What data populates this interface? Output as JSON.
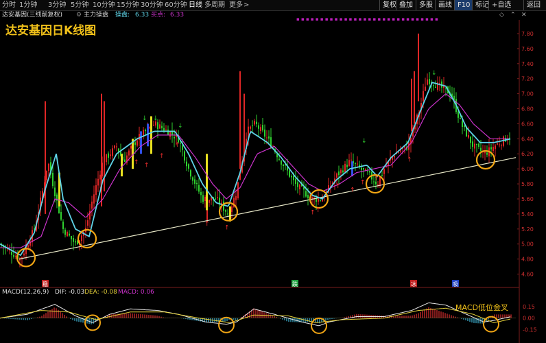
{
  "topbar": {
    "periods": [
      "分时",
      "1分钟",
      "3分钟",
      "5分钟",
      "10分钟",
      "15分钟",
      "30分钟",
      "60分钟",
      "日线",
      "多周期",
      "更多"
    ],
    "active": "日线",
    "right_buttons": [
      "复权",
      "叠加",
      "多股",
      "画线",
      "F10",
      "标记",
      "+自选",
      "返回"
    ],
    "more_arrow": ">"
  },
  "titlebar": {
    "stock_label": "达安基因(三线前复权)",
    "indicator_name": "主力操盘",
    "op_label": "操盘:",
    "op_value": "6.33",
    "buy_label": "买点:",
    "buy_value": "6.33"
  },
  "overlay_title": "达安基因日K线图",
  "macd": {
    "label": "MACD(12,26,9)",
    "dif": "DIF: -0.03",
    "dea": "DEA: -0.08",
    "macd": "MACD: 0.06",
    "note": "MACD低位金叉"
  },
  "signal_labels": [
    "稳",
    "跌",
    "冰",
    "吸"
  ],
  "colors": {
    "up": "#e02626",
    "down": "#2fd02f",
    "fast_line": "#5fd4e8",
    "slow_line": "#cc33cc",
    "trend_line": "#e8e8c8",
    "circle": "#f2a614",
    "axis_text": "#d03030"
  },
  "chart_data": [
    {
      "type": "candlestick",
      "title": "达安基因日K线图",
      "y_ticks": [
        "7.80",
        "7.60",
        "7.40",
        "7.20",
        "7.00",
        "6.80",
        "6.60",
        "6.40",
        "6.20",
        "6.00",
        "5.80",
        "5.60",
        "5.40",
        "5.20",
        "5.00",
        "4.80",
        "4.60"
      ],
      "ylim": [
        4.55,
        7.9
      ],
      "close_keypoints": [
        [
          0,
          5.0
        ],
        [
          30,
          4.8
        ],
        [
          50,
          5.2
        ],
        [
          62,
          5.7
        ],
        [
          70,
          6.1
        ],
        [
          82,
          5.6
        ],
        [
          92,
          5.2
        ],
        [
          110,
          5.0
        ],
        [
          125,
          5.2
        ],
        [
          135,
          5.6
        ],
        [
          150,
          6.1
        ],
        [
          170,
          6.3
        ],
        [
          180,
          6.1
        ],
        [
          200,
          6.4
        ],
        [
          225,
          6.6
        ],
        [
          245,
          6.5
        ],
        [
          260,
          6.4
        ],
        [
          275,
          6.0
        ],
        [
          295,
          5.6
        ],
        [
          315,
          5.6
        ],
        [
          333,
          5.4
        ],
        [
          345,
          5.7
        ],
        [
          360,
          6.5
        ],
        [
          372,
          6.6
        ],
        [
          390,
          6.4
        ],
        [
          410,
          6.1
        ],
        [
          430,
          5.8
        ],
        [
          455,
          5.6
        ],
        [
          470,
          5.6
        ],
        [
          490,
          5.9
        ],
        [
          510,
          6.1
        ],
        [
          525,
          6.0
        ],
        [
          540,
          5.9
        ],
        [
          550,
          5.8
        ],
        [
          560,
          6.0
        ],
        [
          575,
          6.2
        ],
        [
          595,
          6.3
        ],
        [
          612,
          6.8
        ],
        [
          622,
          7.2
        ],
        [
          640,
          7.1
        ],
        [
          658,
          7.0
        ],
        [
          672,
          6.6
        ],
        [
          690,
          6.3
        ],
        [
          707,
          6.2
        ],
        [
          720,
          6.3
        ],
        [
          745,
          6.45
        ]
      ],
      "series": [
        {
          "name": "操盘",
          "values": [
            [
              0,
              5.0
            ],
            [
              30,
              4.85
            ],
            [
              50,
              5.15
            ],
            [
              65,
              5.7
            ],
            [
              82,
              6.2
            ],
            [
              92,
              5.6
            ],
            [
              110,
              5.2
            ],
            [
              130,
              5.1
            ],
            [
              150,
              5.85
            ],
            [
              170,
              6.2
            ],
            [
              200,
              6.4
            ],
            [
              225,
              6.5
            ],
            [
              255,
              6.5
            ],
            [
              275,
              6.2
            ],
            [
              295,
              5.8
            ],
            [
              315,
              5.55
            ],
            [
              333,
              5.5
            ],
            [
              350,
              5.95
            ],
            [
              365,
              6.5
            ],
            [
              390,
              6.35
            ],
            [
              410,
              6.15
            ],
            [
              430,
              5.9
            ],
            [
              455,
              5.65
            ],
            [
              470,
              5.6
            ],
            [
              490,
              5.85
            ],
            [
              510,
              6.0
            ],
            [
              535,
              6.05
            ],
            [
              550,
              5.9
            ],
            [
              570,
              6.15
            ],
            [
              595,
              6.35
            ],
            [
              612,
              6.75
            ],
            [
              630,
              7.15
            ],
            [
              650,
              7.1
            ],
            [
              665,
              6.85
            ],
            [
              680,
              6.55
            ],
            [
              700,
              6.35
            ],
            [
              720,
              6.35
            ],
            [
              745,
              6.4
            ]
          ]
        },
        {
          "name": "买点",
          "values": [
            [
              0,
              4.95
            ],
            [
              30,
              4.95
            ],
            [
              60,
              5.1
            ],
            [
              80,
              5.6
            ],
            [
              100,
              5.55
            ],
            [
              125,
              5.35
            ],
            [
              150,
              5.6
            ],
            [
              175,
              6.0
            ],
            [
              205,
              6.3
            ],
            [
              230,
              6.45
            ],
            [
              260,
              6.45
            ],
            [
              285,
              6.15
            ],
            [
              310,
              5.8
            ],
            [
              330,
              5.6
            ],
            [
              350,
              5.75
            ],
            [
              375,
              6.2
            ],
            [
              400,
              6.3
            ],
            [
              425,
              6.05
            ],
            [
              450,
              5.8
            ],
            [
              470,
              5.7
            ],
            [
              495,
              5.8
            ],
            [
              520,
              5.95
            ],
            [
              545,
              6.0
            ],
            [
              570,
              6.05
            ],
            [
              600,
              6.35
            ],
            [
              625,
              6.8
            ],
            [
              650,
              7.0
            ],
            [
              670,
              6.85
            ],
            [
              690,
              6.6
            ],
            [
              715,
              6.4
            ],
            [
              745,
              6.4
            ]
          ]
        }
      ],
      "trendline": [
        [
          28,
          4.8
        ],
        [
          752,
          6.15
        ]
      ]
    },
    {
      "type": "bar",
      "title": "MACD(12,26,9)",
      "y_ticks": [
        "0.15",
        "0.00",
        "-0.15"
      ],
      "ylim": [
        -0.28,
        0.32
      ],
      "dif_keypoints": [
        [
          0,
          0.0
        ],
        [
          40,
          0.05
        ],
        [
          80,
          0.18
        ],
        [
          110,
          0.03
        ],
        [
          135,
          -0.06
        ],
        [
          160,
          0.05
        ],
        [
          190,
          0.12
        ],
        [
          230,
          0.1
        ],
        [
          260,
          0.05
        ],
        [
          300,
          -0.05
        ],
        [
          330,
          -0.08
        ],
        [
          345,
          -0.05
        ],
        [
          370,
          0.12
        ],
        [
          400,
          0.05
        ],
        [
          440,
          -0.05
        ],
        [
          465,
          -0.1
        ],
        [
          480,
          -0.05
        ],
        [
          520,
          0.02
        ],
        [
          560,
          0.02
        ],
        [
          600,
          0.1
        ],
        [
          625,
          0.2
        ],
        [
          650,
          0.17
        ],
        [
          680,
          0.05
        ],
        [
          705,
          -0.05
        ],
        [
          720,
          -0.03
        ],
        [
          745,
          0.02
        ]
      ],
      "dea_keypoints": [
        [
          0,
          0.0
        ],
        [
          60,
          0.1
        ],
        [
          100,
          0.08
        ],
        [
          140,
          -0.02
        ],
        [
          190,
          0.08
        ],
        [
          240,
          0.08
        ],
        [
          290,
          0.0
        ],
        [
          335,
          -0.06
        ],
        [
          370,
          0.04
        ],
        [
          420,
          0.03
        ],
        [
          460,
          -0.06
        ],
        [
          500,
          -0.02
        ],
        [
          560,
          0.0
        ],
        [
          610,
          0.1
        ],
        [
          650,
          0.13
        ],
        [
          690,
          0.05
        ],
        [
          720,
          -0.06
        ],
        [
          745,
          -0.01
        ]
      ]
    }
  ]
}
